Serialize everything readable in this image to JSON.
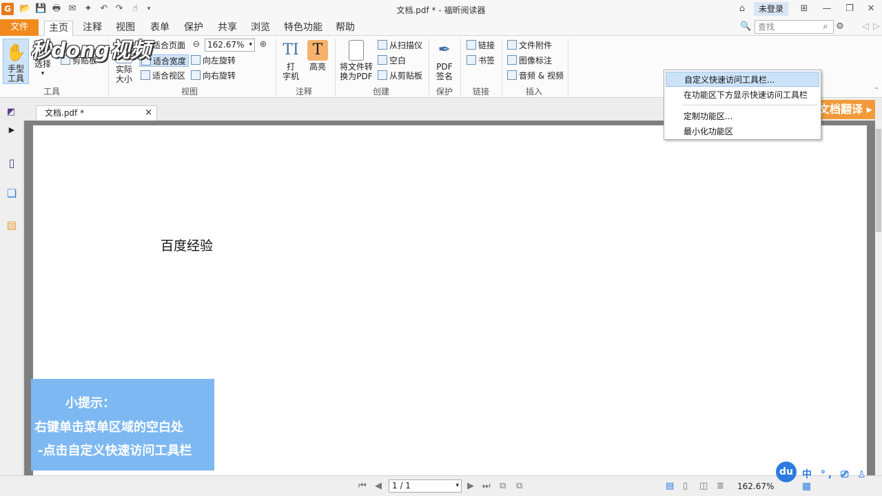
{
  "window": {
    "title": "文档.pdf * - 福昕阅读器",
    "login": "未登录"
  },
  "menu": {
    "file": "文件",
    "items": [
      "主页",
      "注释",
      "视图",
      "表单",
      "保护",
      "共享",
      "浏览",
      "特色功能",
      "帮助"
    ],
    "active": "主页",
    "search_placeholder": "查找"
  },
  "ribbon": {
    "tools": {
      "hand_tool": "手型\n工具",
      "select": "选择",
      "clipboard": "剪贴板",
      "group": "工具"
    },
    "view": {
      "actual_size": "实际\n大小",
      "fit_page": "适合页面",
      "fit_width": "适合宽度",
      "fit_visible": "适合视区",
      "zoom_value": "162.67%",
      "rotate_left": "向左旋转",
      "rotate_right": "向右旋转",
      "group": "视图"
    },
    "annotate": {
      "typewriter": "打\n字机",
      "highlight": "高亮",
      "group": "注释"
    },
    "create": {
      "convert_pdf": "将文件转\n换为PDF",
      "from_scanner": "从扫描仪",
      "blank": "空白",
      "from_clipboard": "从剪贴板",
      "group": "创建"
    },
    "protect": {
      "pdf_sign": "PDF\n签名",
      "group": "保护"
    },
    "links": {
      "link": "链接",
      "bookmark": "书签",
      "group": "链接"
    },
    "insert": {
      "file_attachment": "文件附件",
      "image_annotation": "图像标注",
      "audio_video": "音频 & 视频",
      "group": "插入"
    }
  },
  "tab": {
    "label": "文档.pdf *",
    "close": "×"
  },
  "document": {
    "text": "百度经验"
  },
  "context_menu": {
    "items": [
      "自定义快速访问工具栏...",
      "在功能区下方显示快速访问工具栏",
      "定制功能区...",
      "最小化功能区"
    ]
  },
  "translate_banner": "文档翻译 ▸",
  "tip": {
    "line1": "小提示：",
    "line2": "右键单击菜单区域的空白处",
    "line3": "-点击自定义快速访问工具栏"
  },
  "status": {
    "page": "1 / 1",
    "zoom": "162.67%"
  },
  "watermark": "秒dong视频",
  "ime": {
    "logo": "du",
    "text": "中 °, ⎚ ♙ ▦"
  },
  "colors": {
    "accent_orange": "#f08a1c",
    "tip_blue": "#7db8f2",
    "highlight_blue": "#cce2f7"
  }
}
